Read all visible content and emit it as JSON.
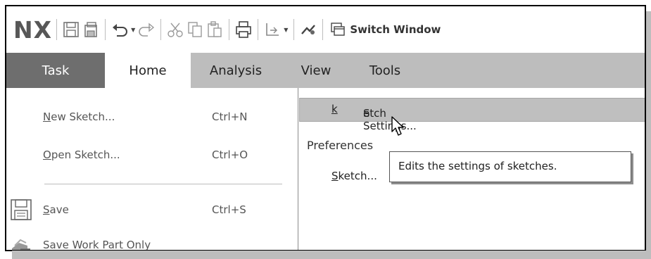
{
  "app": {
    "logo": "NX"
  },
  "toolbar": {
    "switch_window_label": "Switch Window",
    "icons": [
      "save-icon",
      "save-all-icon",
      "undo-icon",
      "redo-icon",
      "cut-icon",
      "copy-icon",
      "paste-icon",
      "print-icon",
      "touch-mode-icon",
      "repeat-command-icon",
      "switch-window-icon"
    ]
  },
  "tabs": [
    {
      "label": "Task"
    },
    {
      "label": "Home"
    },
    {
      "label": "Analysis"
    },
    {
      "label": "View"
    },
    {
      "label": "Tools"
    }
  ],
  "task_menu": {
    "new_sketch": {
      "label_u": "N",
      "label_rest": "ew Sketch...",
      "shortcut": "Ctrl+N"
    },
    "open_sketch": {
      "label_u": "O",
      "label_rest": "pen Sketch...",
      "shortcut": "Ctrl+O"
    },
    "save": {
      "label_u": "S",
      "label_rest": "ave",
      "shortcut": "Ctrl+S"
    },
    "save_work_part": {
      "label": "Save Work Part Only"
    }
  },
  "submenu": {
    "sketch_settings": {
      "pre": "S",
      "u": "k",
      "post": "etch Settings..."
    },
    "preferences_heading": "Preferences",
    "sketch_item": {
      "u": "S",
      "post": "ketch..."
    }
  },
  "tooltip": {
    "text": "Edits the settings of sketches."
  }
}
